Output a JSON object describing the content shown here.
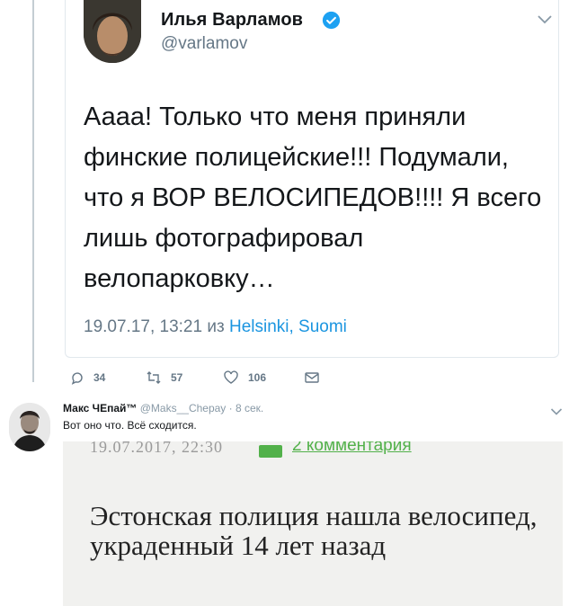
{
  "tweet": {
    "author_name": "Илья Варламов",
    "author_handle": "@varlamov",
    "text": "Аааа! Только что меня приняли финские полицейские!!! Подумали, что я ВОР ВЕЛОСИПЕДОВ!!!! Я всего лишь фотографировал велопарковку…",
    "date": "19.07.17, 13:21",
    "from_label": "из",
    "location": "Helsinki, Suomi",
    "icons": {
      "verified": "verified-badge-icon",
      "menu": "chevron-down-icon"
    }
  },
  "actions": {
    "replies": "34",
    "retweets": "57",
    "likes": "106",
    "icons": [
      "reply-icon",
      "retweet-icon",
      "like-icon",
      "message-icon"
    ]
  },
  "reply": {
    "name": "Макс ЧЕпай™",
    "handle": "@Maks__Chepay",
    "separator": "·",
    "time": "8 сек.",
    "text": "Вот оно что. Всё сходится."
  },
  "embedded_image": {
    "date": "19.07.2017, 22:30",
    "comments": "2 комментария",
    "headline": "Эстонская полиция нашла велосипед, украденный 14 лет назад"
  },
  "colors": {
    "link": "#1b95e0",
    "muted": "#657786",
    "verified": "#1da1f2",
    "news_green": "#52b14a"
  }
}
